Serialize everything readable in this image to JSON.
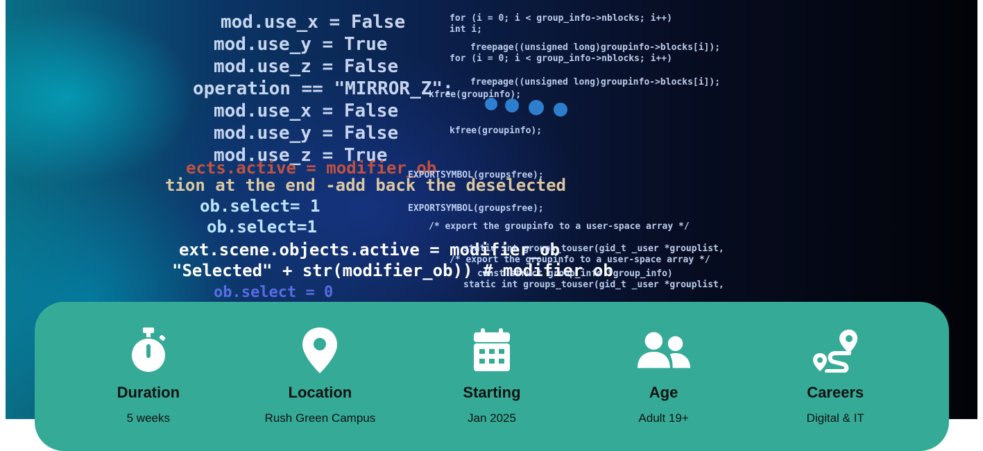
{
  "hero": {
    "code_lines": [
      "mod.use_x = False",
      "mod.use_y = True",
      "mod.use_z = False",
      "operation == \"MIRROR_Z\":",
      "mod.use_x = False",
      "mod.use_y = False",
      "mod.use_z = True",
      "ects.active = modifier_ob",
      "tion at the end -add back the deselected",
      "ob.select= 1",
      "ob.select=1",
      "ext.scene.objects.active = modifier_ob",
      "\"Selected\" + str(modifier_ob)) # modifier ob",
      "ob.select = 0"
    ],
    "code_lines_right": [
      "for (i = 0; i < group_info->nblocks; i++)",
      "int i;",
      "freepage((unsigned long)groupinfo->blocks[i]);",
      "for (i = 0; i < group_info->nblocks; i++)",
      "freepage((unsigned long)groupinfo->blocks[i]);",
      "kfree(groupinfo);",
      "kfree(groupinfo);",
      "EXPORTSYMBOL(groupsfree);",
      "EXPORTSYMBOL(groupsfree);",
      "/* export the groupinfo to a user-space array */",
      "static int groups_touser(gid_t _user *grouplist,",
      "/* export the groupinfo to a user-space array */",
      "const struct group_info *group_info)",
      "static int groups_touser(gid_t _user *grouplist,"
    ]
  },
  "info": {
    "items": [
      {
        "label": "Duration",
        "value": "5 weeks",
        "icon": "stopwatch-icon"
      },
      {
        "label": "Location",
        "value": "Rush Green Campus",
        "icon": "map-pin-icon"
      },
      {
        "label": "Starting",
        "value": "Jan 2025",
        "icon": "calendar-icon"
      },
      {
        "label": "Age",
        "value": "Adult 19+",
        "icon": "users-icon"
      },
      {
        "label": "Careers",
        "value": "Digital & IT",
        "icon": "route-icon"
      }
    ]
  },
  "colors": {
    "bar": "#35ab97",
    "text": "#111111",
    "icon": "#ffffff"
  }
}
